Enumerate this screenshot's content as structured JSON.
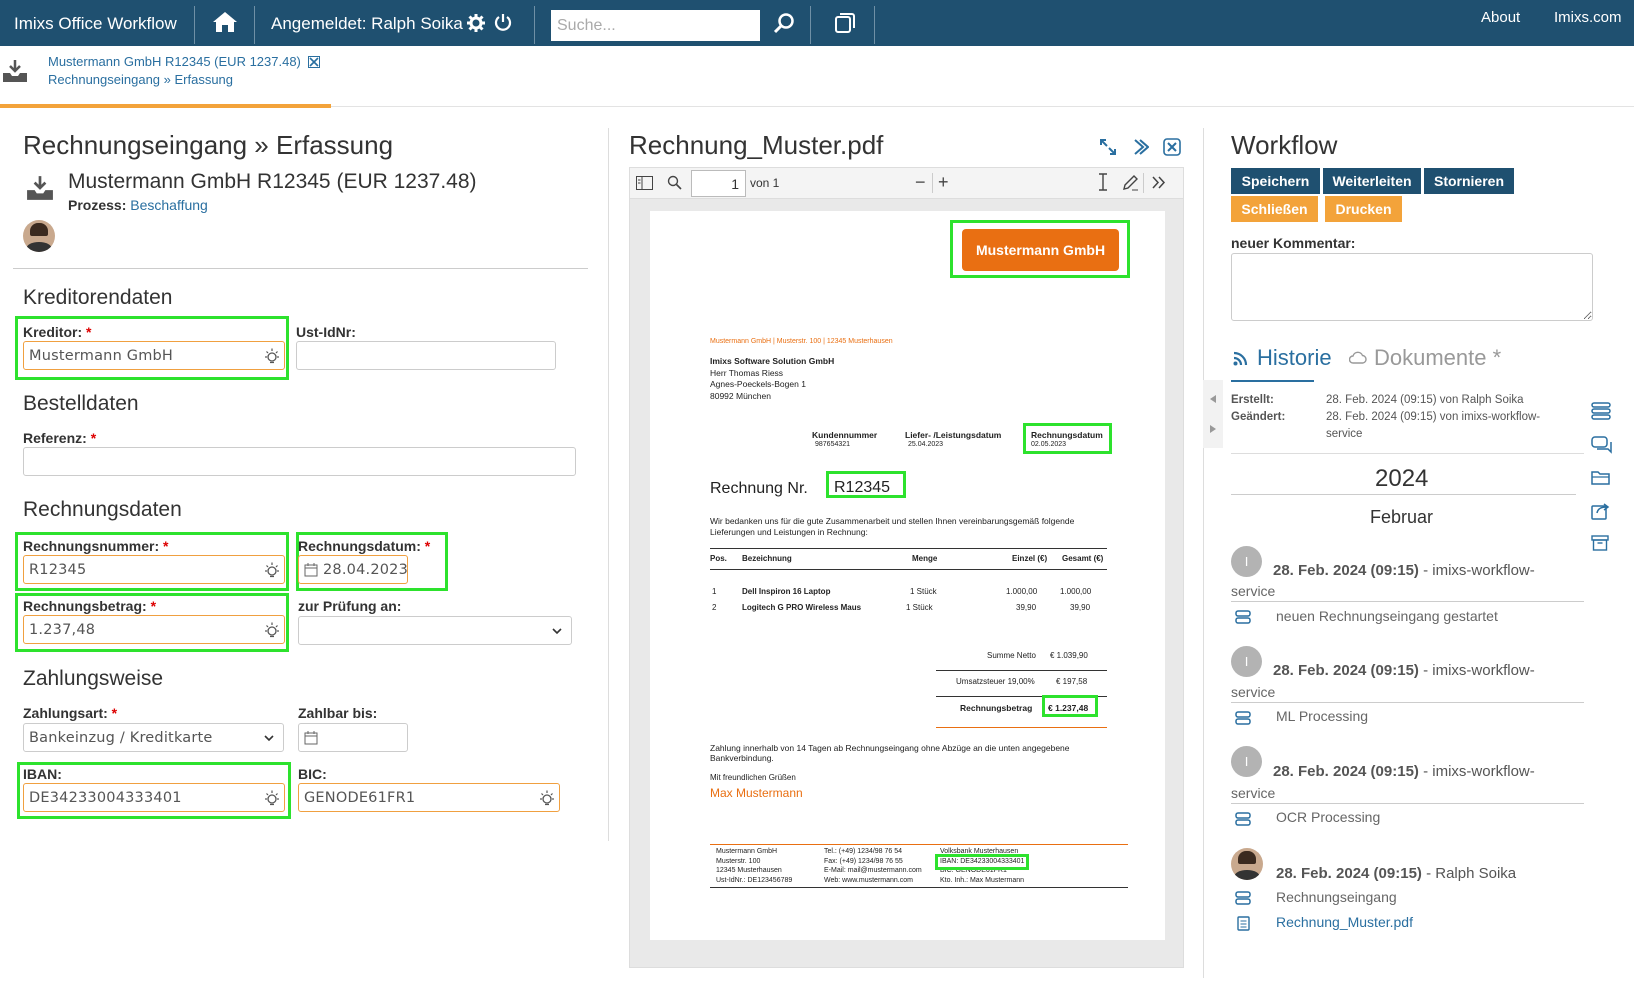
{
  "topbar": {
    "app_title": "Imixs Office Workflow",
    "logged_in": "Angemeldet: Ralph Soika",
    "search_placeholder": "Suche...",
    "about": "About",
    "site": "Imixs.com"
  },
  "breadcrumb": {
    "line1": "Mustermann GmbH R12345 (EUR 1237.48)",
    "line2": "Rechnungseingang » Erfassung"
  },
  "form": {
    "title": "Rechnungseingang » Erfassung",
    "subject": "Mustermann GmbH R12345 (EUR 1237.48)",
    "process_label": "Prozess:",
    "process_value": "Beschaffung",
    "sections": {
      "kreditor": "Kreditorendaten",
      "bestell": "Bestelldaten",
      "rechnung": "Rechnungsdaten",
      "zahlung": "Zahlungsweise"
    },
    "fields": {
      "kreditor_label": "Kreditor:",
      "kreditor_value": "Mustermann GmbH",
      "ustid_label": "Ust-IdNr:",
      "ustid_value": "",
      "referenz_label": "Referenz:",
      "referenz_value": "",
      "nummer_label": "Rechnungsnummer:",
      "nummer_value": "R12345",
      "datum_label": "Rechnungsdatum:",
      "datum_value": "28.04.2023",
      "betrag_label": "Rechnungsbetrag:",
      "betrag_value": "1.237,48",
      "pruefung_label": "zur Prüfung an:",
      "pruefung_value": "",
      "zahlungsart_label": "Zahlungsart:",
      "zahlungsart_value": "Bankeinzug / Kreditkarte",
      "zahlbar_label": "Zahlbar bis:",
      "zahlbar_value": "",
      "iban_label": "IBAN:",
      "iban_value": "DE34233004333401",
      "bic_label": "BIC:",
      "bic_value": "GENODE61FR1"
    },
    "required_mark": "*"
  },
  "pdf": {
    "filename": "Rechnung_Muster.pdf",
    "page_number": "1",
    "page_count": "von 1",
    "doc": {
      "logo": "Mustermann GmbH",
      "sender_line": "Mustermann GmbH | Musterstr. 100 | 12345 Musterhausen",
      "recipient": [
        "Imixs Software Solution GmbH",
        "Herr Thomas Riess",
        "Agnes-Poeckels-Bogen 1",
        "80992 München"
      ],
      "meta": [
        {
          "label": "Kundennummer",
          "value": "987654321"
        },
        {
          "label": "Liefer- /Leistungsdatum",
          "value": "25.04.2023"
        },
        {
          "label": "Rechnungsdatum",
          "value": "02.05.2023"
        }
      ],
      "title": "Rechnung Nr.",
      "number": "R12345",
      "intro1": "Wir bedanken uns für die gute Zusammenarbeit und stellen Ihnen vereinbarungsgemäß folgende",
      "intro2": "Lieferungen und Leistungen in Rechnung:",
      "table_headers": [
        "Pos.",
        "Bezeichnung",
        "Menge",
        "Einzel (€)",
        "Gesamt (€)"
      ],
      "rows": [
        [
          "1",
          "Dell Inspiron 16 Laptop",
          "1 Stück",
          "1.000,00",
          "1.000,00"
        ],
        [
          "2",
          "Logitech G PRO Wireless Maus",
          "1 Stück",
          "39,90",
          "39,90"
        ]
      ],
      "netto_label": "Summe Netto",
      "netto_value": "€ 1.039,90",
      "ust_label": "Umsatzsteuer 19,00%",
      "ust_value": "€ 197,58",
      "total_label": "Rechnungsbetrag",
      "total_value": "€ 1.237,48",
      "terms1": "Zahlung innerhalb von 14 Tagen ab Rechnungseingang ohne Abzüge an die unten angegebene",
      "terms2": "Bankverbindung.",
      "greeting": "Mit freundlichen Grüßen",
      "signature": "Max Mustermann",
      "footer_col1": [
        "Mustermann GmbH",
        "Musterstr. 100",
        "12345 Musterhausen",
        "Ust-IdNr.: DE123456789"
      ],
      "footer_col2": [
        "Tel.: (+49) 1234/98 76 54",
        "Fax: (+49) 1234/98 76 55",
        "E-Mail: mail@mustermann.com",
        "Web: www.mustermann.com"
      ],
      "footer_col3": [
        "Volksbank Musterhausen",
        "IBAN: DE34233004333401",
        "BIC: GENODE61FR1",
        "Kto. Inh.: Max Mustermann"
      ]
    }
  },
  "workflow": {
    "title": "Workflow",
    "buttons": [
      "Speichern",
      "Weiterleiten",
      "Stornieren",
      "Schließen",
      "Drucken"
    ],
    "comment_label": "neuer Kommentar:",
    "tabs": {
      "history": "Historie",
      "documents": "Dokumente *"
    },
    "created_label": "Erstellt:",
    "created_value": "28. Feb. 2024 (09:15) von Ralph Soika",
    "modified_label": "Geändert:",
    "modified_value_1": "28. Feb. 2024 (09:15) von imixs-workflow-",
    "modified_value_2": "service",
    "year": "2024",
    "month": "Februar",
    "entries": [
      {
        "avatar": "I",
        "date": "28. Feb. 2024 (09:15)",
        "by": " - imixs-workflow-",
        "by2": "service",
        "text": "neuen Rechnungseingang gestartet"
      },
      {
        "avatar": "I",
        "date": "28. Feb. 2024 (09:15)",
        "by": " - imixs-workflow-",
        "by2": "service",
        "text": "ML Processing"
      },
      {
        "avatar": "I",
        "date": "28. Feb. 2024 (09:15)",
        "by": " - imixs-workflow-",
        "by2": "service",
        "text": "OCR Processing"
      },
      {
        "date": "28. Feb. 2024 (09:15)",
        "by": " - Ralph Soika",
        "text": "Rechnungseingang",
        "file": "Rechnung_Muster.pdf"
      }
    ]
  },
  "colors": {
    "primary": "#1f5070",
    "accent": "#f3a33a",
    "highlight": "#2de22d",
    "link": "#2a6fa0"
  }
}
